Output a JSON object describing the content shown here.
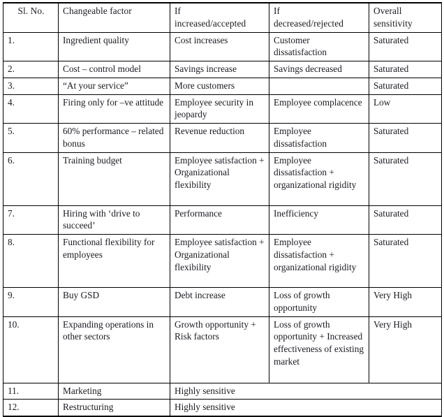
{
  "table": {
    "columns": [
      {
        "key": "sl",
        "label": "Sl. No."
      },
      {
        "key": "factor",
        "label": "Changeable factor"
      },
      {
        "key": "inc",
        "label": "If increased/accepted"
      },
      {
        "key": "dec",
        "label": "If decreased/rejected"
      },
      {
        "key": "overall",
        "label": "Overall sensitivity"
      }
    ],
    "header_lines": {
      "sl": "Sl. No.",
      "factor": "Changeable factor",
      "inc_line1": "If",
      "inc_line2": "increased/accepted",
      "dec_line1": "If",
      "dec_line2": "decreased/rejected",
      "overall_line1": "Overall",
      "overall_line2": "sensitivity"
    },
    "merged_value": "Highly sensitive",
    "rows": [
      {
        "sl": "1.",
        "factor": "Ingredient quality",
        "inc": "Cost increases",
        "dec": "Customer dissatisfaction",
        "overall": "Saturated"
      },
      {
        "sl": "2.",
        "factor": "Cost – control model",
        "inc": "Savings increase",
        "dec": "Savings decreased",
        "overall": "Saturated"
      },
      {
        "sl": "3.",
        "factor": "“At your service”",
        "inc": "More customers",
        "dec": "",
        "overall": "Saturated"
      },
      {
        "sl": "4.",
        "factor": "Firing only for –ve attitude",
        "inc": "Employee security in jeopardy",
        "dec": "Employee complacence",
        "overall": "Low"
      },
      {
        "sl": "5.",
        "factor": "60% performance – related bonus",
        "inc": "Revenue reduction",
        "dec": "Employee dissatisfaction",
        "overall": "Saturated"
      },
      {
        "sl": "6.",
        "factor": "Training budget",
        "inc": "Employee satisfaction + Organizational flexibility",
        "dec": "Employee dissatisfaction + organizational rigidity",
        "overall": "Saturated"
      },
      {
        "sl": "7.",
        "factor": "Hiring with ‘drive to succeed’",
        "inc": "Performance",
        "dec": "Inefficiency",
        "overall": "Saturated"
      },
      {
        "sl": "8.",
        "factor": "Functional flexibility for employees",
        "inc": "Employee satisfaction + Organizational flexibility",
        "dec": "Employee dissatisfaction + organizational rigidity",
        "overall": "Saturated"
      },
      {
        "sl": "9.",
        "factor": "Buy GSD",
        "inc": "Debt increase",
        "dec": "Loss of growth opportunity",
        "overall": "Very High"
      },
      {
        "sl": "10.",
        "factor": "Expanding operations in other sectors",
        "inc": "Growth opportunity + Risk factors",
        "dec": "Loss of growth opportunity + Increased effectiveness of existing market",
        "overall": "Very High"
      },
      {
        "sl": "11.",
        "factor": "Marketing",
        "merged": "Highly sensitive"
      },
      {
        "sl": "12.",
        "factor": "Restructuring",
        "merged": "Highly sensitive"
      }
    ]
  }
}
